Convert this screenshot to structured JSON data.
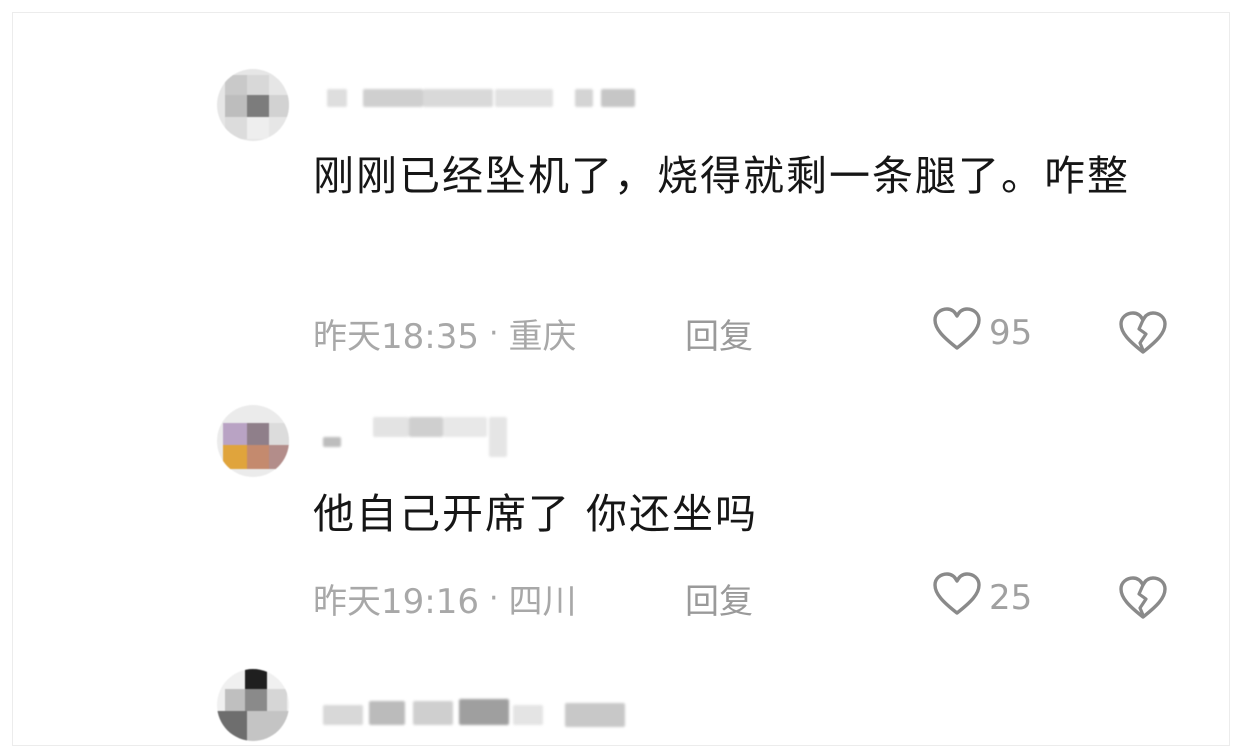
{
  "comments": [
    {
      "text": "刚刚已经坠机了，烧得就剩一条腿了。咋整",
      "time": "昨天18:35",
      "location": "重庆",
      "reply_label": "回复",
      "likes": "95"
    },
    {
      "text": "他自己开席了 你还坐吗",
      "time": "昨天19:16",
      "location": "四川",
      "reply_label": "回复",
      "likes": "25"
    }
  ],
  "separator": "·",
  "icons": {
    "like": "heart-outline-icon",
    "dislike": "broken-heart-icon"
  },
  "colors": {
    "meta": "#a8a8a8",
    "body": "#161616",
    "icon_stroke": "#8a8a8a"
  }
}
